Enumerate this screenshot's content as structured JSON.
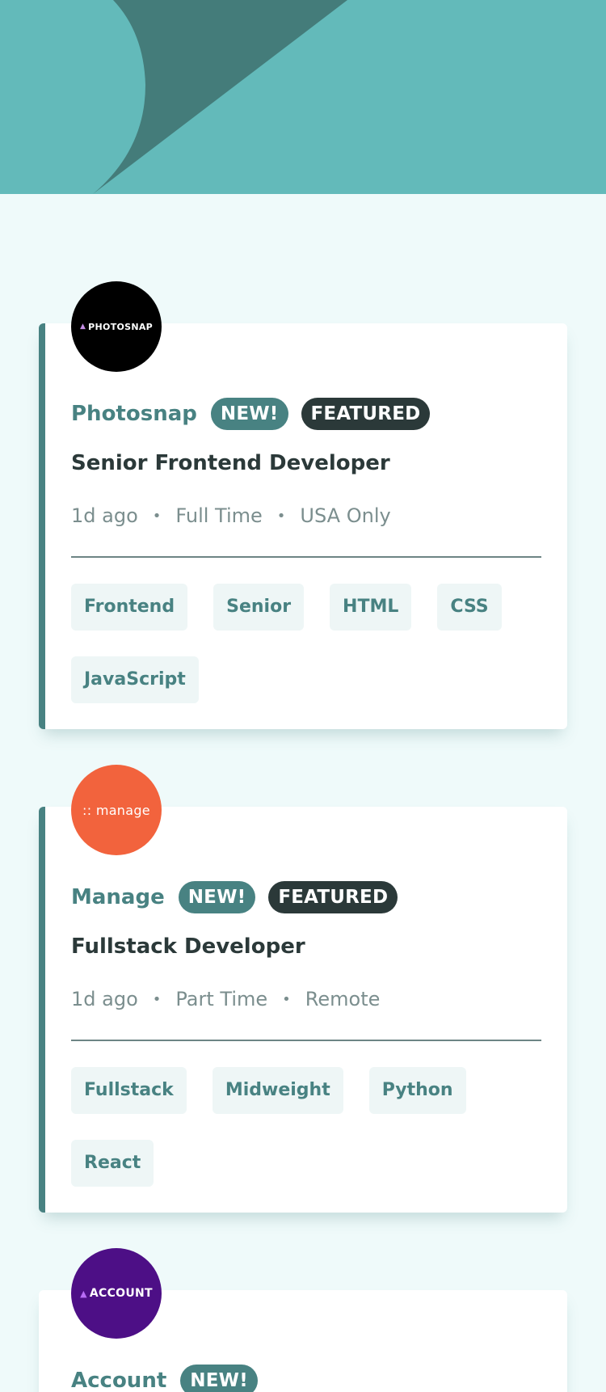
{
  "colors": {
    "header_bg": "#63baba",
    "header_shape": "#447c7a",
    "page_bg": "#effafa",
    "primary": "#488282",
    "dark": "#2b3939",
    "muted": "#7b8e8e",
    "tag_bg": "#eef6f6"
  },
  "jobs": [
    {
      "logo": {
        "text": "PHOTOSNAP",
        "icon": "triangle-icon",
        "bg": "#000000",
        "fg": "#ffffff",
        "icon_color": "#c48de3"
      },
      "company": "Photosnap",
      "new_label": "NEW!",
      "featured_label": "FEATURED",
      "position": "Senior Frontend Developer",
      "posted": "1d ago",
      "contract": "Full Time",
      "location": "USA Only",
      "separator": "•",
      "tags": [
        "Frontend",
        "Senior",
        "HTML",
        "CSS",
        "JavaScript"
      ]
    },
    {
      "logo": {
        "text": ":: manage",
        "icon": "",
        "bg": "#f2633d",
        "fg": "#ffffff",
        "icon_color": "#ffffff"
      },
      "company": "Manage",
      "new_label": "NEW!",
      "featured_label": "FEATURED",
      "position": "Fullstack Developer",
      "posted": "1d ago",
      "contract": "Part Time",
      "location": "Remote",
      "separator": "•",
      "tags": [
        "Fullstack",
        "Midweight",
        "Python",
        "React"
      ]
    },
    {
      "logo": {
        "text": "ACCOUNT",
        "icon": "triangle-icon",
        "bg": "#4d0f86",
        "fg": "#ffffff",
        "icon_color": "#b86cf5"
      },
      "company": "Account",
      "new_label": "NEW!"
    }
  ]
}
